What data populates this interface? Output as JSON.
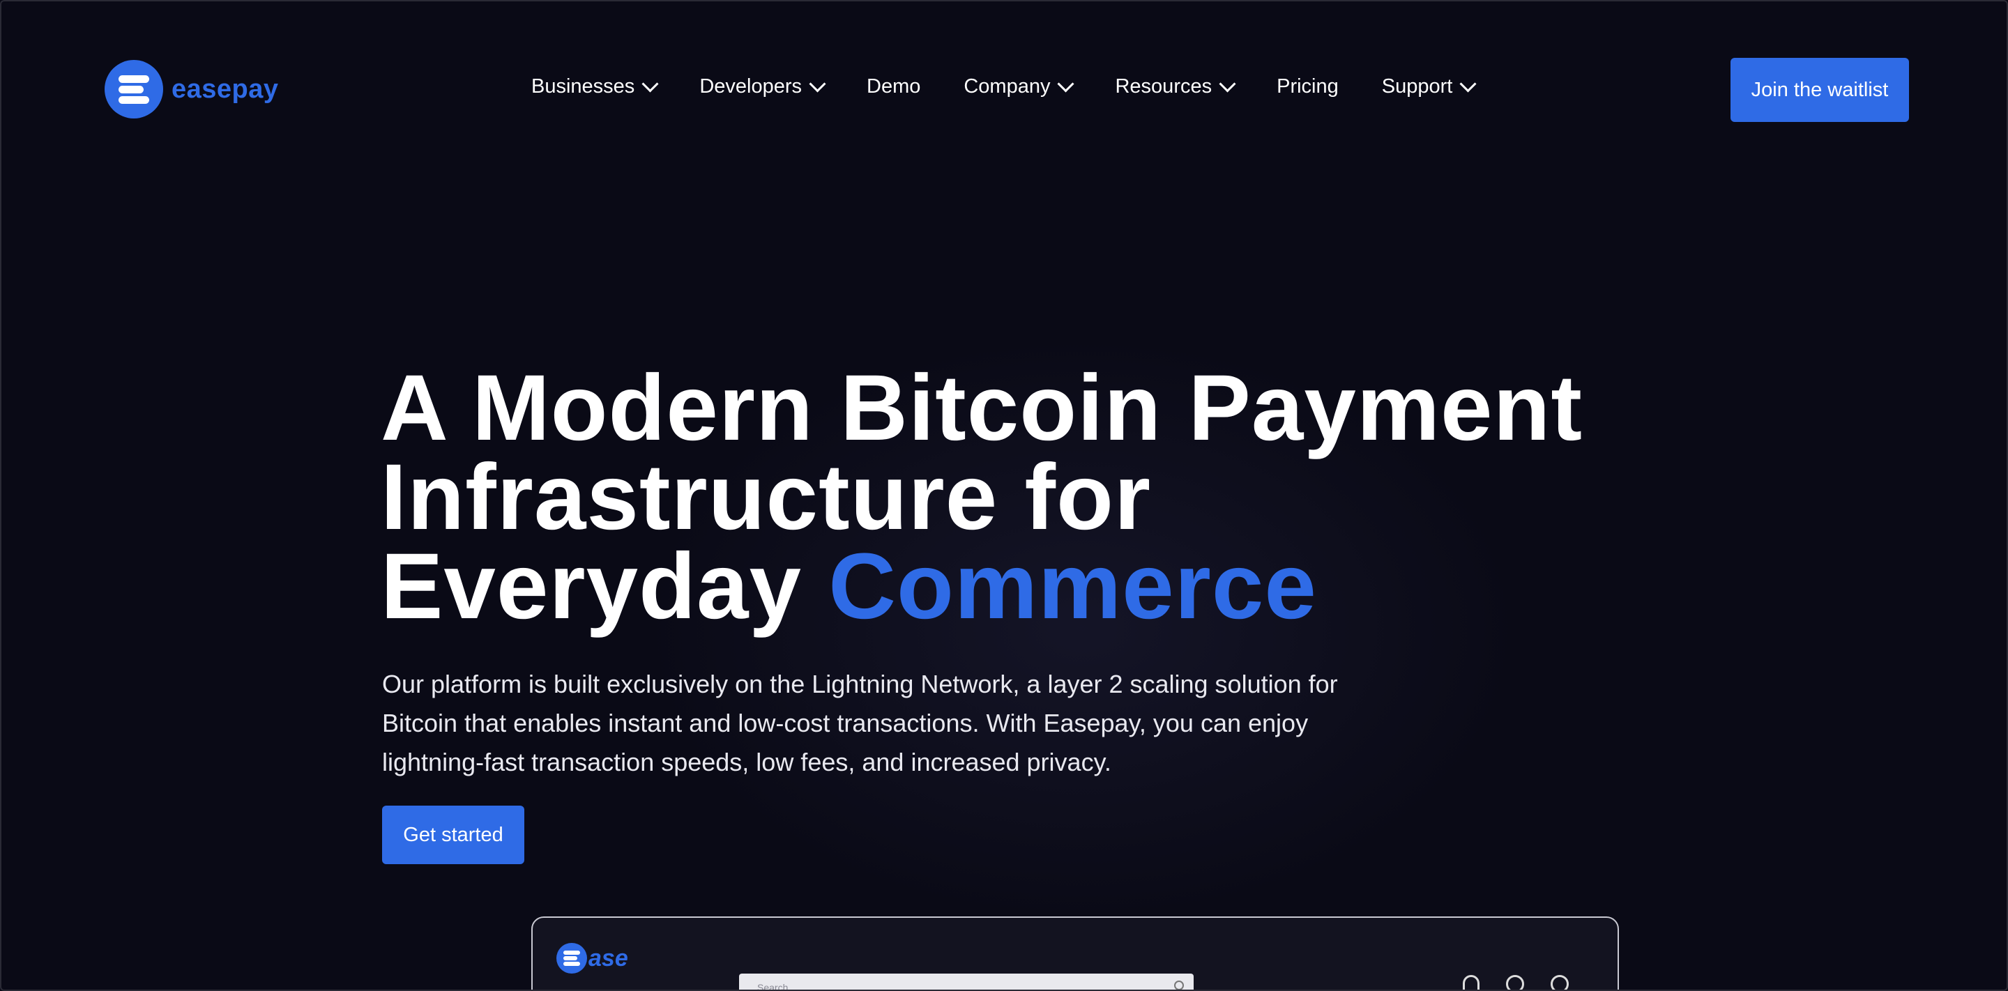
{
  "brand": {
    "name": "easepay",
    "color": "#2f6be6"
  },
  "nav": {
    "items": [
      {
        "label": "Businesses",
        "dropdown": true
      },
      {
        "label": "Developers",
        "dropdown": true
      },
      {
        "label": "Demo",
        "dropdown": false
      },
      {
        "label": "Company",
        "dropdown": true
      },
      {
        "label": "Resources",
        "dropdown": true
      },
      {
        "label": "Pricing",
        "dropdown": false
      },
      {
        "label": "Support",
        "dropdown": true
      }
    ],
    "cta_label": "Join the waitlist"
  },
  "hero": {
    "title_line1": "A Modern Bitcoin Payment",
    "title_line2": "Infrastructure for",
    "title_line3_plain": "Everyday",
    "title_line3_accent": "Commerce",
    "description": "Our platform is built exclusively on the Lightning Network, a layer 2 scaling solution for Bitcoin that enables instant and low-cost transactions. With Easepay, you can enjoy lightning-fast transaction speeds, low fees, and increased privacy.",
    "cta_label": "Get started"
  },
  "preview": {
    "logo_text": "ase",
    "search_placeholder": "Search",
    "icons": [
      "bell-icon",
      "help-icon",
      "user-icon"
    ]
  }
}
